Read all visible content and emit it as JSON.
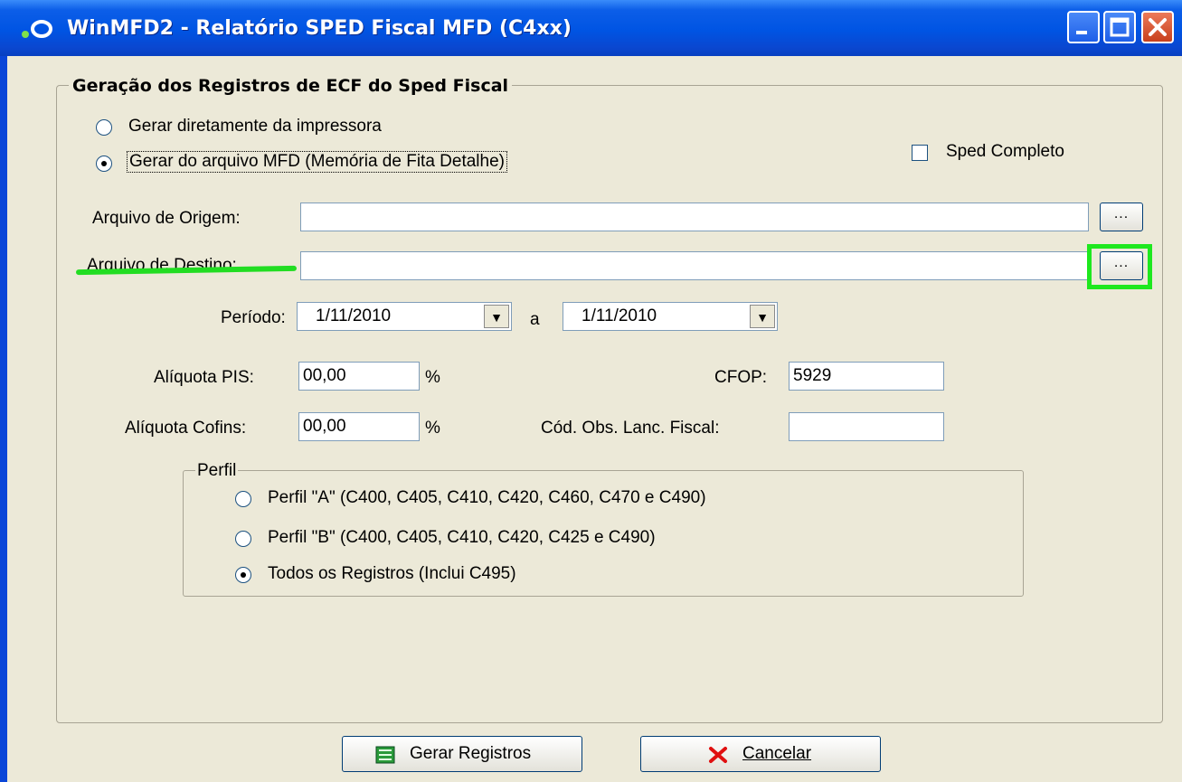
{
  "window": {
    "title": "WinMFD2 - Relatório SPED Fiscal MFD (C4xx)"
  },
  "group": {
    "title": "Geração dos Registros de ECF do Sped Fiscal",
    "radio_printer": "Gerar diretamente da impressora",
    "radio_mfd": "Gerar do arquivo MFD (Memória de Fita Detalhe)",
    "sped_completo": "Sped Completo",
    "origem_label": "Arquivo de Origem:",
    "origem_value": "",
    "destino_label": "Arquivo de Destino:",
    "destino_value": "",
    "browse_label": "...",
    "periodo_label": "Período:",
    "periodo_from": "1/11/2010",
    "periodo_sep": "a",
    "periodo_to": "1/11/2010",
    "pis_label": "Alíquota PIS:",
    "pis_value": "00,00",
    "cofins_label": "Alíquota Cofins:",
    "cofins_value": "00,00",
    "percent": "%",
    "cfop_label": "CFOP:",
    "cfop_value": "5929",
    "obs_label": "Cód. Obs. Lanc. Fiscal:",
    "obs_value": ""
  },
  "perfil": {
    "title": "Perfil",
    "option_a": "Perfil \"A\" (C400, C405, C410, C420, C460, C470 e C490)",
    "option_b": "Perfil \"B\" (C400, C405, C410, C420, C425 e C490)",
    "option_all": "Todos os Registros (Inclui C495)"
  },
  "buttons": {
    "gerar": "Gerar Registros",
    "cancelar": "Cancelar"
  }
}
